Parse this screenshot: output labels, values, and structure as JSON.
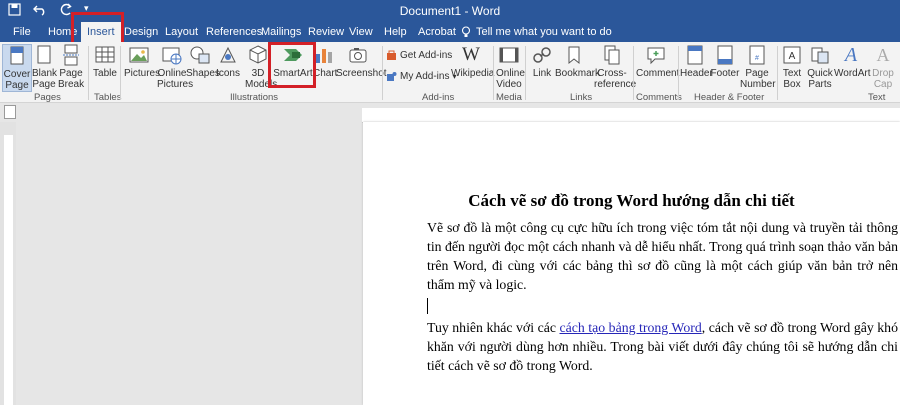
{
  "window": {
    "title": "Document1 - Word"
  },
  "qat": {
    "save_icon": "save-icon",
    "undo_icon": "undo-icon",
    "redo_icon": "redo-icon"
  },
  "tabs": [
    "File",
    "Home",
    "Insert",
    "Design",
    "Layout",
    "References",
    "Mailings",
    "Review",
    "View",
    "Help",
    "Acrobat"
  ],
  "active_tab": "Insert",
  "tell_me": "Tell me what you want to do",
  "ribbon": {
    "pages": {
      "cover": "Cover\nPage",
      "blank": "Blank\nPage",
      "break": "Page\nBreak",
      "group": "Pages"
    },
    "tables": {
      "table": "Table",
      "group": "Tables"
    },
    "illustrations": {
      "pictures": "Pictures",
      "online_pictures": "Online\nPictures",
      "shapes": "Shapes",
      "icons": "Icons",
      "models": "3D\nModels",
      "smartart": "SmartArt",
      "chart": "Chart",
      "screenshot": "Screenshot",
      "group": "Illustrations"
    },
    "addins": {
      "get": "Get Add-ins",
      "my": "My Add-ins",
      "wikipedia": "Wikipedia",
      "group": "Add-ins"
    },
    "media": {
      "online_video": "Online\nVideo",
      "group": "Media"
    },
    "links": {
      "link": "Link",
      "bookmark": "Bookmark",
      "cross": "Cross-\nreference",
      "group": "Links"
    },
    "comments": {
      "comment": "Comment",
      "group": "Comments"
    },
    "header_footer": {
      "header": "Header",
      "footer": "Footer",
      "page_number": "Page\nNumber",
      "group": "Header & Footer"
    },
    "text": {
      "textbox": "Text\nBox",
      "quick": "Quick\nParts",
      "wordart": "WordArt",
      "dropcap": "Drop\nCap",
      "group": "Text"
    }
  },
  "document": {
    "heading": "Cách vẽ sơ đồ trong Word hướng dẫn chi tiết",
    "para1": "Vẽ sơ đồ là một công cụ cực hữu ích trong việc tóm tắt nội dung và truyền tải thông tin đến người đọc một cách nhanh và dễ hiểu nhất. Trong quá trình soạn thảo văn bản trên Word, đi cùng với các bảng thì sơ đồ cũng là một cách giúp văn bản trở nên thẩm mỹ và logic.",
    "para2_before": "Tuy nhiên khác với các ",
    "para2_link": "cách tạo bảng trong Word",
    "para2_after": ", cách vẽ sơ đồ trong Word gây khó khăn với người dùng hơn nhiều. Trong bài viết dưới đây chúng tôi sẽ hướng dẫn chi tiết cách vẽ sơ đồ trong Word."
  },
  "colors": {
    "word_blue": "#2b579a",
    "highlight_red": "#d32027",
    "link_blue": "#2626b8"
  }
}
